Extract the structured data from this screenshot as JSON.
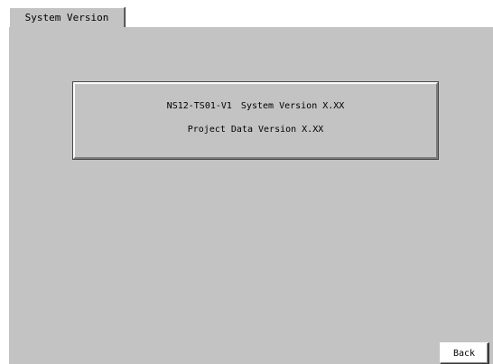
{
  "tab": {
    "label": "System Version"
  },
  "info": {
    "model": "NS12-TS01-V1",
    "system_version": "System Version X.XX",
    "project_data_version": "Project Data Version X.XX"
  },
  "buttons": {
    "back_label": "Back"
  },
  "colors": {
    "panel_background": "#c3c3c3",
    "screen_background": "#ffffff"
  }
}
